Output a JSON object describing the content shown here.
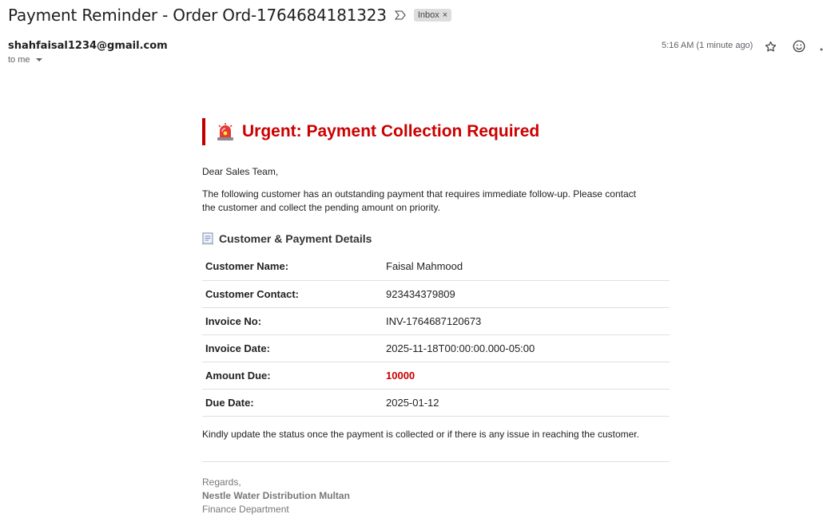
{
  "email": {
    "subject": "Payment Reminder - Order Ord-1764684181323",
    "label_chip": "Inbox",
    "label_close": "×",
    "sender": "shahfaisal1234@gmail.com",
    "recipient": "to me",
    "time": "5:16 AM (1 minute ago)",
    "icons": [
      "label-importance-icon",
      "star-icon",
      "emoji-reaction-icon",
      "more-icon"
    ]
  },
  "body": {
    "title": "Urgent: Payment Collection Required",
    "title_icon": "siren-icon",
    "greeting": "Dear Sales Team,",
    "intro": "The following customer has an outstanding payment that requires immediate follow-up. Please contact the customer and collect the pending amount on priority.",
    "section_title": "Customer & Payment Details",
    "section_icon": "receipt-icon",
    "details": [
      {
        "label": "Customer Name:",
        "value": "Faisal Mahmood"
      },
      {
        "label": "Customer Contact:",
        "value": "923434379809"
      },
      {
        "label": "Invoice No:",
        "value": "INV-1764687120673"
      },
      {
        "label": "Invoice Date:",
        "value": "2025-11-18T00:00:00.000-05:00"
      },
      {
        "label": "Amount Due:",
        "value": "10000"
      },
      {
        "label": "Due Date:",
        "value": "2025-01-12"
      }
    ],
    "closing_note": "Kindly update the status once the payment is collected or if there is any issue in reaching the customer.",
    "regards": "Regards,",
    "organization": "Nestle Water Distribution Multan",
    "department": "Finance Department"
  },
  "colors": {
    "accent_red": "#cc0000",
    "muted_text": "#5f6368"
  }
}
